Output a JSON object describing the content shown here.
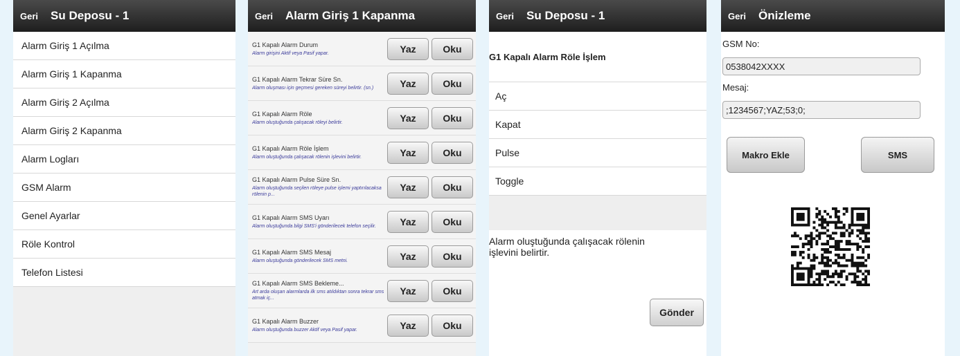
{
  "panel1": {
    "back": "Geri",
    "title": "Su Deposu - 1",
    "items": [
      "Alarm Giriş 1 Açılma",
      "Alarm Giriş 1 Kapanma",
      "Alarm Giriş 2 Açılma",
      "Alarm Giriş 2 Kapanma",
      "Alarm Logları",
      "GSM Alarm",
      "Genel Ayarlar",
      "Röle Kontrol",
      "Telefon Listesi"
    ]
  },
  "panel2": {
    "back": "Geri",
    "title": "Alarm Giriş 1 Kapanma",
    "write_label": "Yaz",
    "read_label": "Oku",
    "rows": [
      {
        "label": "G1 Kapalı Alarm Durum",
        "desc": "Alarm girişini Aktif veya Pasif yapar."
      },
      {
        "label": "G1 Kapalı Alarm Tekrar Süre Sn.",
        "desc": "Alarm oluşması için geçmesi gereken süreyi belirtir. (sn.)"
      },
      {
        "label": "G1 Kapalı Alarm Röle",
        "desc": "Alarm oluştuğunda çalışacak röleyi belirtir."
      },
      {
        "label": "G1 Kapalı Alarm Röle İşlem",
        "desc": "Alarm oluştuğunda çalışacak rölenin işlevini belirtir."
      },
      {
        "label": "G1 Kapalı Alarm Pulse Süre Sn.",
        "desc": "Alarm oluştuğunda seçilen röleye pulse işlemi yaptırılacaksa rölenin p..."
      },
      {
        "label": "G1 Kapalı Alarm SMS Uyarı",
        "desc": "Alarm oluştuğunda bilgi SMS'i gönderilecek telefon seçilir."
      },
      {
        "label": "G1 Kapalı Alarm SMS Mesaj",
        "desc": "Alarm oluştuğunda gönderilecek SMS metni."
      },
      {
        "label": "G1 Kapalı Alarm SMS Bekleme...",
        "desc": "Art arda oluşan alarmlarda ilk sms atıldıktan sonra tekrar sms atmak iç..."
      },
      {
        "label": "G1 Kapalı Alarm Buzzer",
        "desc": "Alarm oluştuğunda buzzer Aktif veya Pasif yapar."
      }
    ]
  },
  "panel3": {
    "back": "Geri",
    "title": "Su Deposu - 1",
    "section": "G1 Kapalı Alarm Röle İşlem",
    "options": [
      "Aç",
      "Kapat",
      "Pulse",
      "Toggle"
    ],
    "help": "Alarm oluştuğunda çalışacak rölenin işlevini belirtir.",
    "send_label": "Gönder"
  },
  "panel4": {
    "back": "Geri",
    "title": "Önizleme",
    "gsm_label": "GSM No:",
    "gsm_value": "0538042XXXX",
    "msg_label": "Mesaj:",
    "msg_value": ";1234567;YAZ;53;0;",
    "macro_label": "Makro Ekle",
    "sms_label": "SMS"
  }
}
